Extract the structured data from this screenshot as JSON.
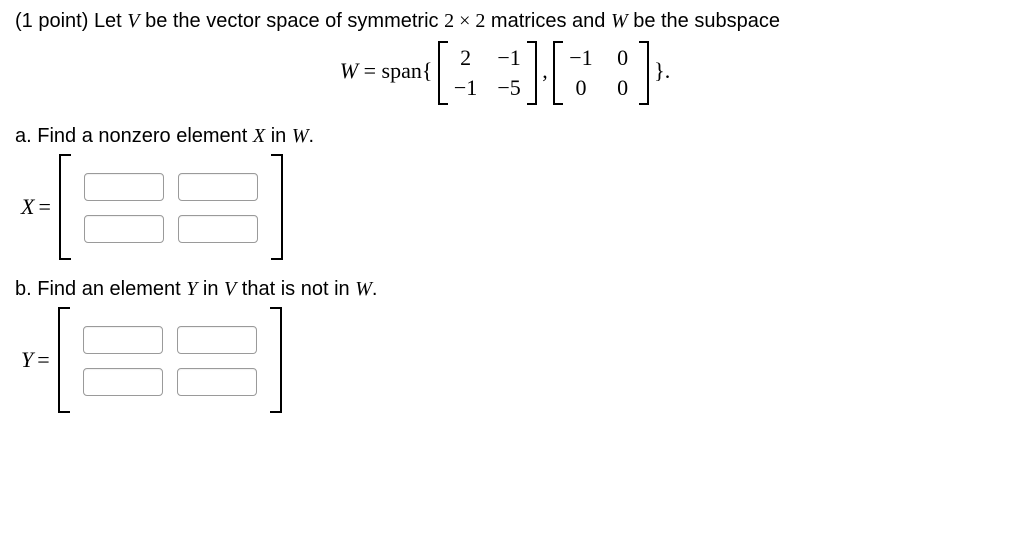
{
  "points_label": "(1 point)",
  "intro_pre": "Let ",
  "V": "V",
  "intro_mid1": " be the vector space of symmetric ",
  "dim": "2 × 2",
  "intro_mid2": " matrices and ",
  "W": "W",
  "intro_end": " be the subspace",
  "span_lhs": "W",
  "span_eq": " = span{",
  "span_comma": ",",
  "span_close": "}.",
  "mat1": {
    "r1c1": "2",
    "r1c2": "−1",
    "r2c1": "−1",
    "r2c2": "−5"
  },
  "mat2": {
    "r1c1": "−1",
    "r1c2": "0",
    "r2c1": "0",
    "r2c2": "0"
  },
  "partA": {
    "label": "a. Find a nonzero element ",
    "var": "X",
    "tail": " in ",
    "set": "W",
    "dot": ".",
    "lhs": "X",
    "eq": "="
  },
  "partB": {
    "label": "b. Find an element ",
    "var": "Y",
    "tail": " in ",
    "set": "V",
    "mid2": " that is not in ",
    "set2": "W",
    "dot": ".",
    "lhs": "Y",
    "eq": "="
  }
}
